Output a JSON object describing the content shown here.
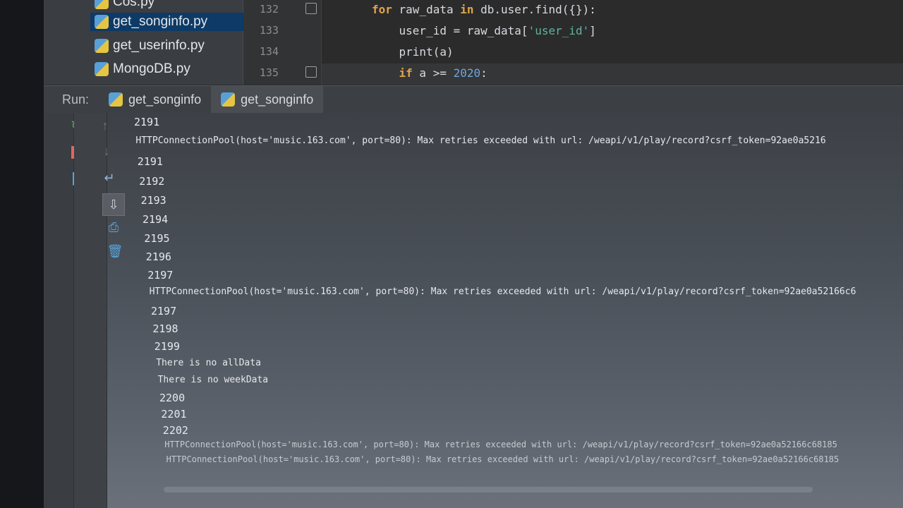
{
  "project_tree": {
    "items": [
      {
        "label": "Cos.py"
      },
      {
        "label": "get_songinfo.py",
        "selected": true
      },
      {
        "label": "get_userinfo.py"
      },
      {
        "label": "MongoDB.py"
      }
    ]
  },
  "editor": {
    "lines": [
      {
        "number": "132",
        "parts": [
          {
            "t": "for",
            "c": "kw"
          },
          {
            "t": " raw_data ",
            "c": ""
          },
          {
            "t": "in",
            "c": "kw"
          },
          {
            "t": " db.user.find({}):",
            "c": ""
          }
        ]
      },
      {
        "number": "133",
        "parts": [
          {
            "t": "    user_id = raw_data[",
            "c": ""
          },
          {
            "t": "'user_id'",
            "c": "str"
          },
          {
            "t": "]",
            "c": ""
          }
        ]
      },
      {
        "number": "134",
        "parts": [
          {
            "t": "    print(a)",
            "c": ""
          }
        ]
      },
      {
        "number": "135",
        "parts": [
          {
            "t": "    ",
            "c": ""
          },
          {
            "t": "if",
            "c": "kw"
          },
          {
            "t": " a >= ",
            "c": ""
          },
          {
            "t": "2020",
            "c": "num"
          },
          {
            "t": ":",
            "c": ""
          }
        ]
      }
    ]
  },
  "run_bar": {
    "label": "Run:",
    "tabs": [
      {
        "label": "get_songinfo",
        "active": false
      },
      {
        "label": "get_songinfo",
        "active": true
      }
    ]
  },
  "console": {
    "lines": [
      "2191",
      "HTTPConnectionPool(host='music.163.com', port=80): Max retries exceeded with url: /weapi/v1/play/record?csrf_token=92ae0a5216",
      "2191",
      "2192",
      "2193",
      "2194",
      "2195",
      "2196",
      "2197",
      "HTTPConnectionPool(host='music.163.com', port=80): Max retries exceeded with url: /weapi/v1/play/record?csrf_token=92ae0a52166c6",
      "2197",
      "2198",
      "2199",
      "There is no allData",
      "There is no weekData",
      "2200",
      "2201",
      "2202",
      "HTTPConnectionPool(host='music.163.com', port=80): Max retries exceeded with url: /weapi/v1/play/record?csrf_token=92ae0a52166c68185",
      "HTTPConnectionPool(host='music.163.com', port=80): Max retries exceeded with url: /weapi/v1/play/record?csrf_token=92ae0a52166c68185"
    ]
  },
  "toolbar_icons": {
    "left": [
      "rerun-icon",
      "stop-icon",
      "pause-icon",
      "layout-icon",
      "pin-icon",
      "close-icon",
      "help-icon"
    ],
    "right": [
      "up-arrow-icon",
      "down-arrow-icon",
      "soft-wrap-icon",
      "scroll-to-end-icon",
      "print-icon",
      "trash-icon"
    ]
  }
}
